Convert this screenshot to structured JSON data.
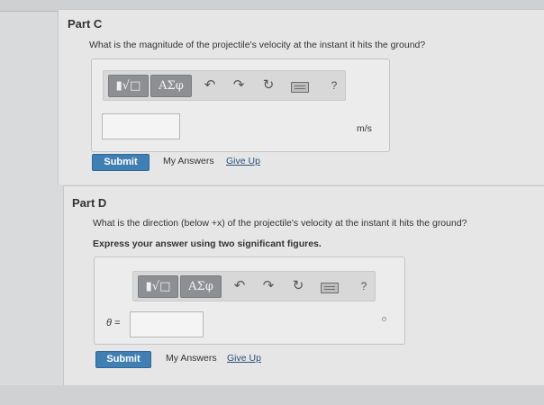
{
  "part_c": {
    "title": "Part C",
    "question": "What is the magnitude of the projectile's velocity at the instant it hits the ground?",
    "toolbar": {
      "template_label": "▮√□",
      "symbols_label": "ΑΣφ",
      "undo_icon": "undo-icon",
      "redo_icon": "redo-icon",
      "reset_icon": "reset-icon",
      "keyboard_icon": "keyboard-icon",
      "help_label": "?"
    },
    "input_value": "",
    "unit": "m/s",
    "submit_label": "Submit",
    "my_answers_label": "My Answers",
    "give_up_label": "Give Up"
  },
  "part_d": {
    "title": "Part D",
    "question": "What is the direction (below +x) of the projectile's velocity at the instant it hits the ground?",
    "instruction": "Express your answer using two significant figures.",
    "toolbar": {
      "template_label": "▮√□",
      "symbols_label": "ΑΣφ",
      "undo_icon": "undo-icon",
      "redo_icon": "redo-icon",
      "reset_icon": "reset-icon",
      "keyboard_icon": "keyboard-icon",
      "help_label": "?"
    },
    "variable_label": "θ =",
    "input_value": "",
    "submit_label": "Submit",
    "my_answers_label": "My Answers",
    "give_up_label": "Give Up"
  },
  "colors": {
    "submit": "#3f7fb3",
    "toolbar_button": "#8d8f92",
    "panel": "#e6e6e6"
  }
}
